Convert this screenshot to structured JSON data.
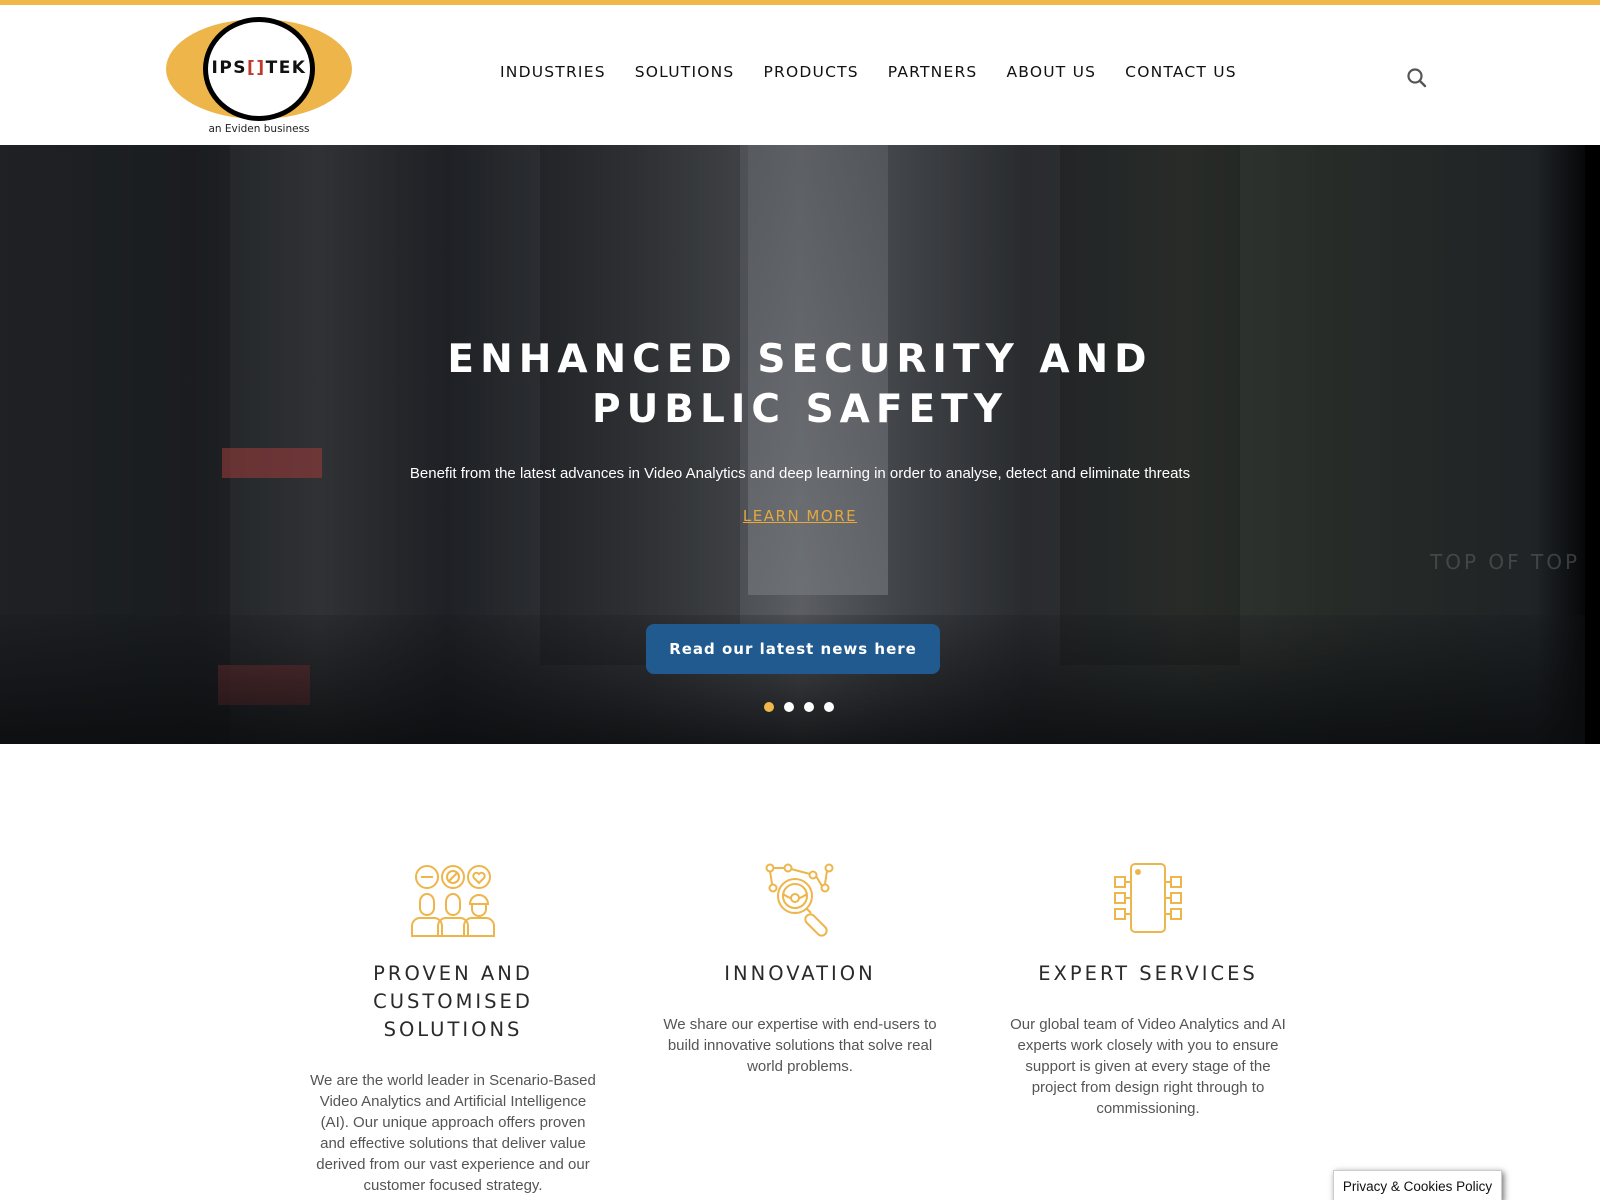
{
  "brand": {
    "logo_text_left": "IPS",
    "logo_text_right": "TEK",
    "tagline": "an Eviden business",
    "accent_color": "#f0b84a",
    "button_color": "#205a8f"
  },
  "nav": {
    "items": [
      {
        "label": "INDUSTRIES"
      },
      {
        "label": "SOLUTIONS"
      },
      {
        "label": "PRODUCTS"
      },
      {
        "label": "PARTNERS"
      },
      {
        "label": "ABOUT US"
      },
      {
        "label": "CONTACT US"
      }
    ],
    "search_icon": "search-icon"
  },
  "hero": {
    "title_line1": "ENHANCED SECURITY AND",
    "title_line2": "PUBLIC SAFETY",
    "subtitle": "Benefit from the latest advances in Video Analytics and deep learning in order to analyse, detect and eliminate threats",
    "learn_more": "LEARN MORE",
    "news_button": "Read our latest news here",
    "background_sign": "TOP OF TOP",
    "carousel": {
      "total_slides": 4,
      "active_slide": 1
    }
  },
  "features": [
    {
      "icon": "people-feedback-icon",
      "title_line1": "PROVEN AND",
      "title_line2": "CUSTOMISED SOLUTIONS",
      "text": "We are the world leader in Scenario-Based Video Analytics and Artificial Intelligence (AI). Our unique approach offers proven and effective solutions that deliver value derived from our vast experience and our customer focused strategy."
    },
    {
      "icon": "magnifier-network-icon",
      "title_line1": "INNOVATION",
      "title_line2": "",
      "text": "We share our expertise with end-users to build innovative solutions that solve real world problems."
    },
    {
      "icon": "microchip-icon",
      "title_line1": "EXPERT SERVICES",
      "title_line2": "",
      "text": "Our global team of Video Analytics and AI experts work closely with you to ensure support is given at every stage of the project from design right through to commissioning."
    }
  ],
  "privacy": {
    "label": "Privacy & Cookies Policy"
  }
}
